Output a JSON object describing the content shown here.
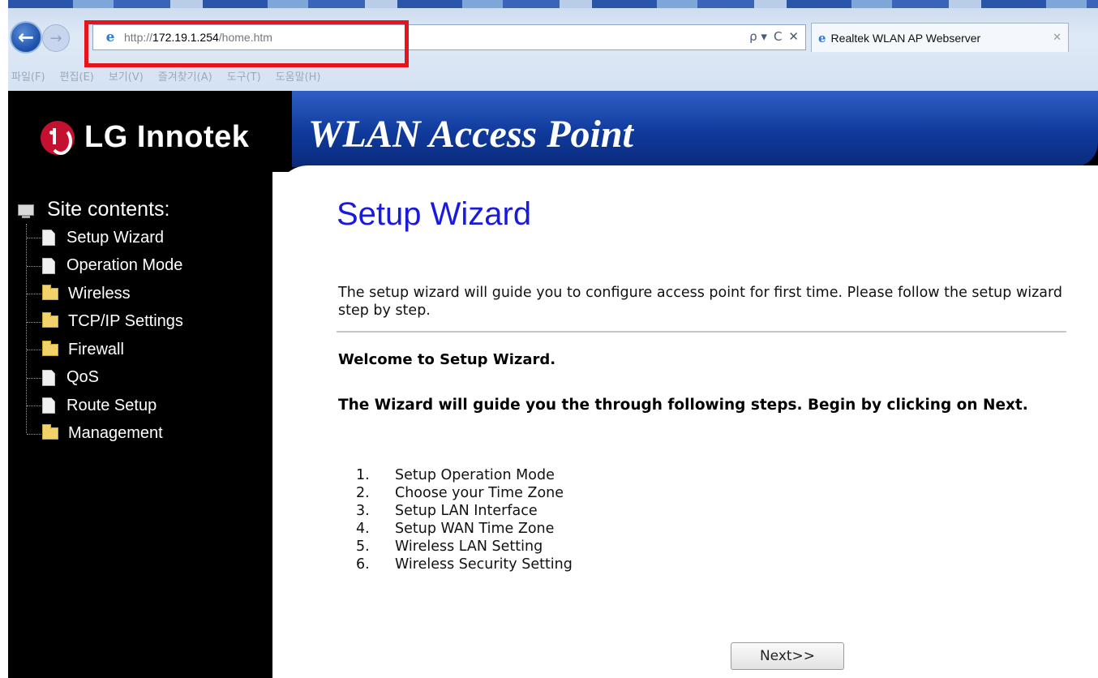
{
  "browser": {
    "url_prefix": "http://",
    "url_host": "172.19.1.254",
    "url_path": "/home.htm",
    "tab_title": "Realtek WLAN AP Webserver",
    "menu": [
      "파일(F)",
      "편집(E)",
      "보기(V)",
      "즐겨찾기(A)",
      "도구(T)",
      "도움말(H)"
    ],
    "tools": {
      "search": "ρ ▾",
      "refresh": "C",
      "close": "✕"
    }
  },
  "header": {
    "logo_text": "LG Innotek",
    "product_title": "WLAN Access Point"
  },
  "sidebar": {
    "title": "Site contents:",
    "items": [
      {
        "label": "Setup Wizard",
        "icon": "document-icon"
      },
      {
        "label": "Operation Mode",
        "icon": "document-icon"
      },
      {
        "label": "Wireless",
        "icon": "folder-icon"
      },
      {
        "label": "TCP/IP Settings",
        "icon": "folder-icon"
      },
      {
        "label": "Firewall",
        "icon": "folder-icon"
      },
      {
        "label": "QoS",
        "icon": "document-icon"
      },
      {
        "label": "Route Setup",
        "icon": "document-icon"
      },
      {
        "label": "Management",
        "icon": "folder-icon"
      }
    ]
  },
  "main": {
    "heading": "Setup Wizard",
    "intro": "The setup wizard will guide you to configure access point for first time. Please follow the setup wizard step by step.",
    "welcome": "Welcome to Setup Wizard.",
    "guide": "The Wizard will guide you the through following steps. Begin by clicking on Next.",
    "steps": [
      {
        "num": "1.",
        "text": "Setup Operation Mode"
      },
      {
        "num": "2.",
        "text": "Choose your Time Zone"
      },
      {
        "num": "3.",
        "text": "Setup LAN Interface"
      },
      {
        "num": "4.",
        "text": "Setup WAN Time Zone"
      },
      {
        "num": "5.",
        "text": "Wireless LAN Setting"
      },
      {
        "num": "6.",
        "text": "Wireless Security Setting"
      }
    ],
    "next_label": "Next>>"
  },
  "colors": {
    "highlight": "#e8141c",
    "heading": "#1a1adc",
    "banner_blue": "#0f3a9c",
    "logo_red": "#c4112f"
  }
}
